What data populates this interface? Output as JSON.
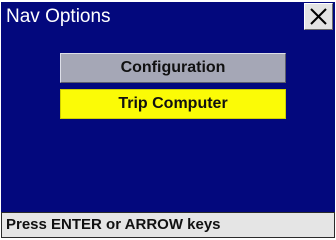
{
  "window": {
    "title": "Nav Options",
    "close_icon": "close-icon"
  },
  "menu": {
    "items": [
      {
        "label": "Configuration",
        "state": "normal"
      },
      {
        "label": "Trip Computer",
        "state": "selected"
      }
    ]
  },
  "status": {
    "text": "Press ENTER or ARROW keys"
  },
  "colors": {
    "background": "#03087d",
    "button_normal": "#a5a7b6",
    "button_selected": "#fbfb06",
    "status_bar": "#e5e5e5"
  }
}
